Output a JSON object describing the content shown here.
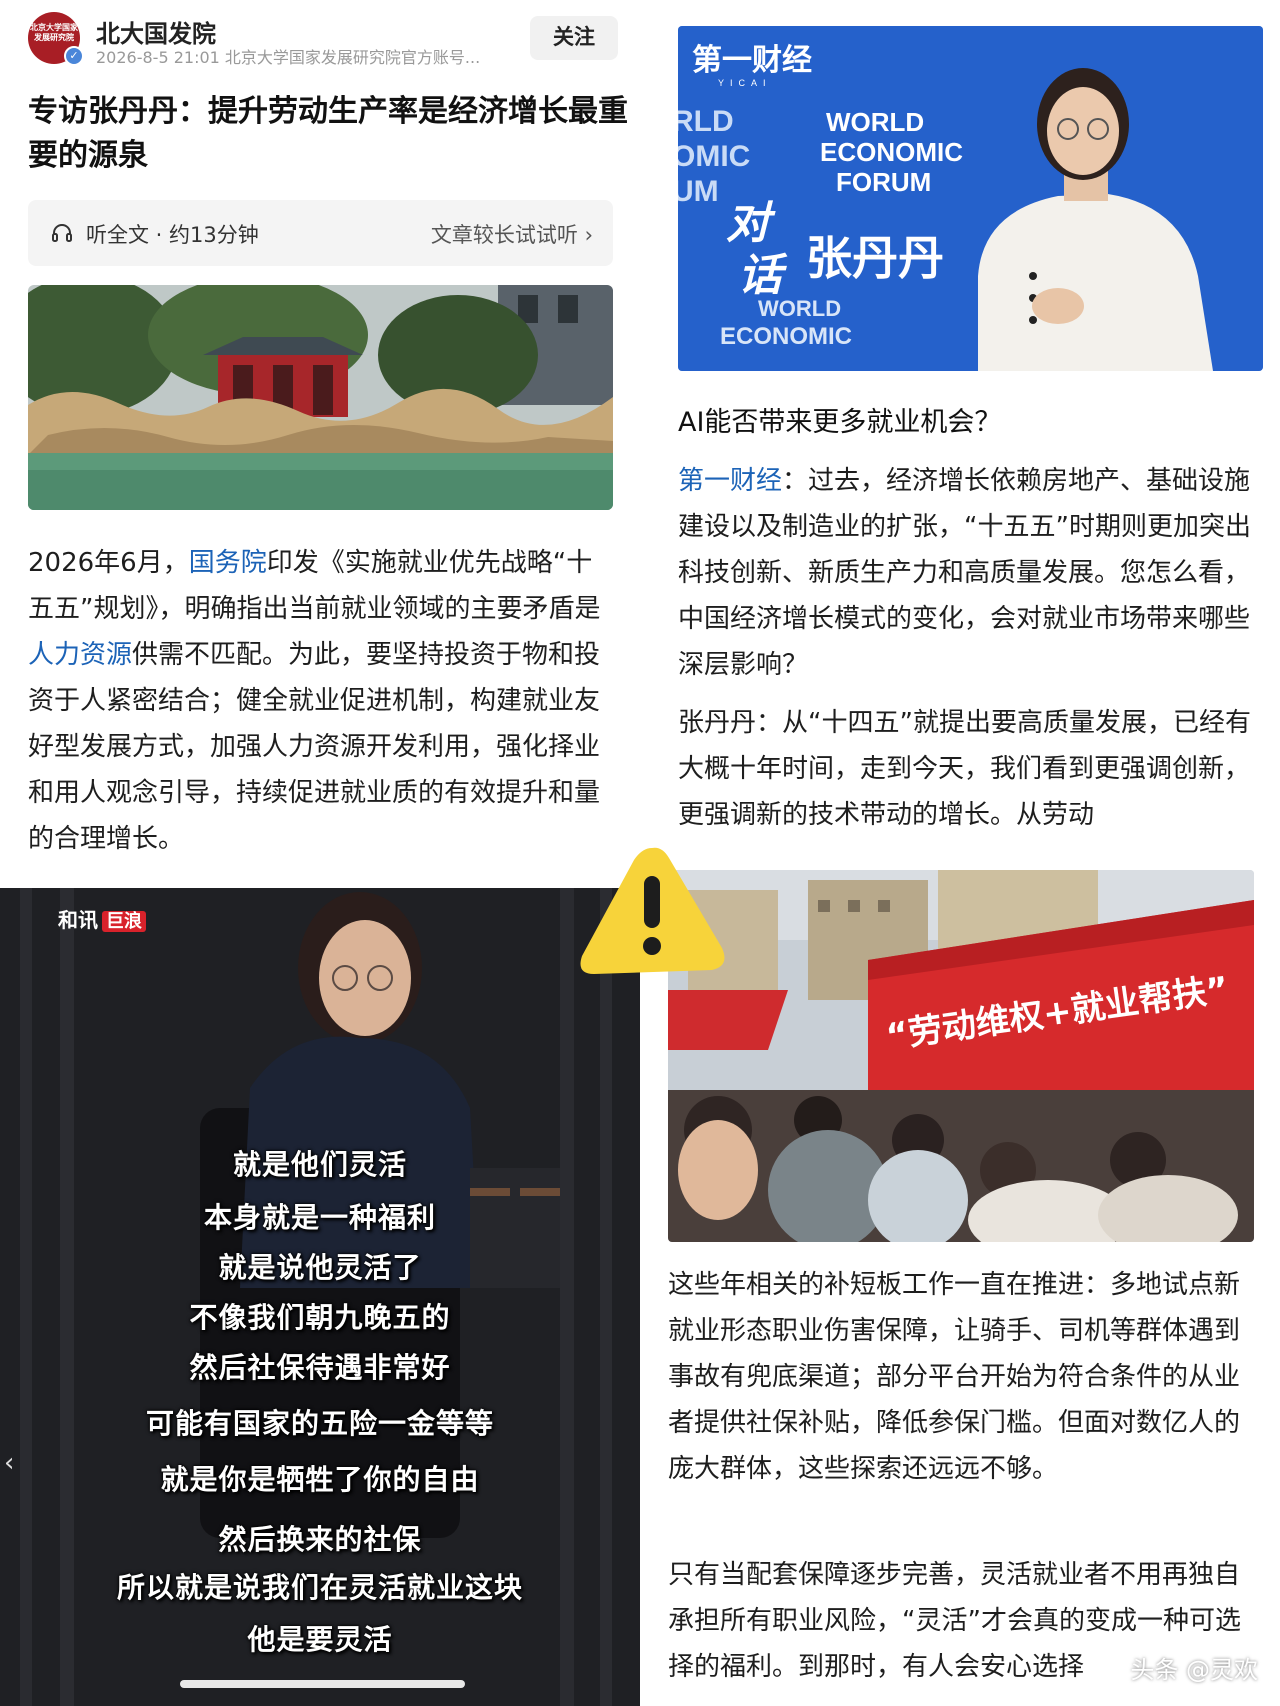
{
  "article": {
    "account_name": "北大国发院",
    "logo_text": "北京大学国家发展研究院",
    "meta": "2026-8-5  21:01  北京大学国家发展研究院官方账号...",
    "follow_label": "关注",
    "title": "专访张丹丹：提升劳动生产率是经济增长最重要的源泉",
    "listen_label": "听全文 · 约13分钟",
    "listen_hint": "文章较长试试听 ›",
    "p1_a": "2026年6月，",
    "p1_link1": "国务院",
    "p1_b": "印发《实施就业优先战略“十五五”规划》，明确指出当前就业领域的主要矛盾是",
    "p1_link2": "人力资源",
    "p1_c": "供需不匹配。为此，要坚持投资于物和投资于人紧密结合；健全就业促进机制，构建就业友好型发展方式，加强人力资源开发利用，强化择业和用人观念引导，持续促进就业质的有效提升和量的合理增长。"
  },
  "interview": {
    "channel_logo": "第一财经",
    "channel_sub": "YICAI",
    "wef_text": "WORLD ECONOMIC FORUM",
    "wef_left": "RLD OMIC UM",
    "caption_dui": "对",
    "caption_hua": "话",
    "caption_name": "张丹丹",
    "heading": "AI能否带来更多就业机会？",
    "q_speaker": "第一财经",
    "q_text": "：过去，经济增长依赖房地产、基础设施建设以及制造业的扩张，“十五五”时期则更加突出科技创新、新质生产力和高质量发展。您怎么看，中国经济增长模式的变化，会对就业市场带来哪些深层影响？",
    "a_text": "张丹丹：从“十四五”就提出要高质量发展，已经有大概十年时间，走到今天，我们看到更强调创新，更强调新的技术带动的增长。从劳动"
  },
  "video": {
    "logo": "和讯",
    "logo_tag": "巨浪",
    "subtitles": [
      "就是他们灵活",
      "本身就是一种福利",
      "就是说他灵活了",
      "不像我们朝九晚五的",
      "然后社保待遇非常好",
      "可能有国家的五险一金等等",
      "就是你是牺牲了你的自由",
      "然后换来的社保",
      "所以就是说我们在灵活就业这块",
      "他是要灵活"
    ]
  },
  "jobfair": {
    "banner": "“劳动维权+就业帮扶”",
    "p1": "这些年相关的补短板工作一直在推进：多地试点新就业形态职业伤害保障，让骑手、司机等群体遇到事故有兜底渠道；部分平台开始为符合条件的从业者提供社保补贴，降低参保门槛。但面对数亿人的庞大群体，这些探索还远远不够。",
    "p2": "只有当配套保障逐步完善，灵活就业者不用再独自承担所有职业风险，“灵活”才会真的变成一种可选择的福利。到那时，有人会安心选择",
    "watermark": "头条 @灵欢"
  },
  "colors": {
    "link_blue": "#1c63b7",
    "brand_red": "#a81e25",
    "warning_yellow": "#f7d33a"
  }
}
